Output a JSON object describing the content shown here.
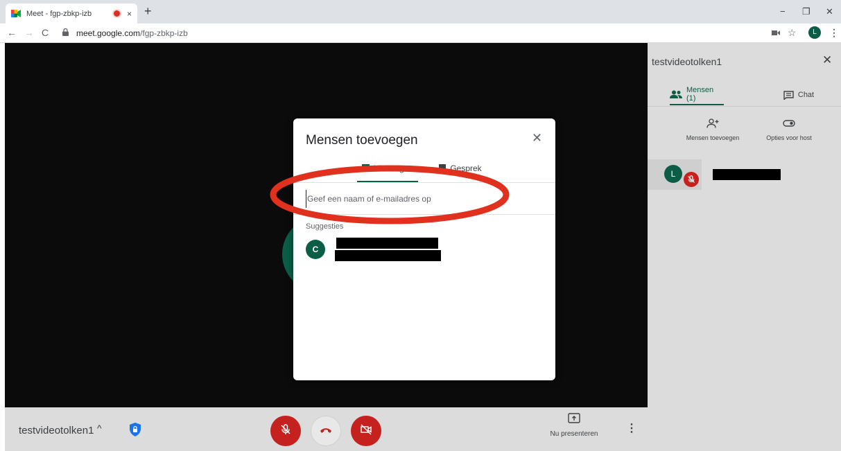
{
  "browser": {
    "tab_title": "Meet - fgp-zbkp-izb",
    "tab_close": "×",
    "new_tab": "+",
    "window_controls": {
      "minimize": "−",
      "restore": "❐",
      "close": "✕"
    },
    "nav": {
      "back": "←",
      "forward": "→",
      "reload": "C"
    },
    "url_host": "meet.google.com",
    "url_path": "/fgp-zbkp-izb",
    "profile_initial": "L",
    "icons": [
      "camera-icon",
      "star-icon",
      "kebab-menu-icon"
    ]
  },
  "meet": {
    "meeting_name": "testvideotolken1",
    "meeting_caret": "^",
    "present_label": "Nu presenteren",
    "more": "⋮"
  },
  "panel": {
    "title": "testvideotolken1",
    "close": "✕",
    "tabs": {
      "people": "Mensen (1)",
      "chat": "Chat"
    },
    "actions": {
      "add_people": "Mensen toevoegen",
      "host_options": "Opties voor host"
    },
    "participant_initial": "L"
  },
  "dialog": {
    "title": "Mensen toevoegen",
    "close": "✕",
    "tabs": {
      "invite": "Uitnodigen",
      "call": "Gesprek"
    },
    "input_placeholder": "Geef een naam of e-mailadres op",
    "suggestions_label": "Suggesties",
    "suggestion_initial": "C"
  },
  "colors": {
    "meet_green": "#0b5d46",
    "danger_red": "#c5221f",
    "annotation_red": "#e0301e",
    "video_bg": "#0b0b0b",
    "panel_bg": "#dcdcdc"
  }
}
